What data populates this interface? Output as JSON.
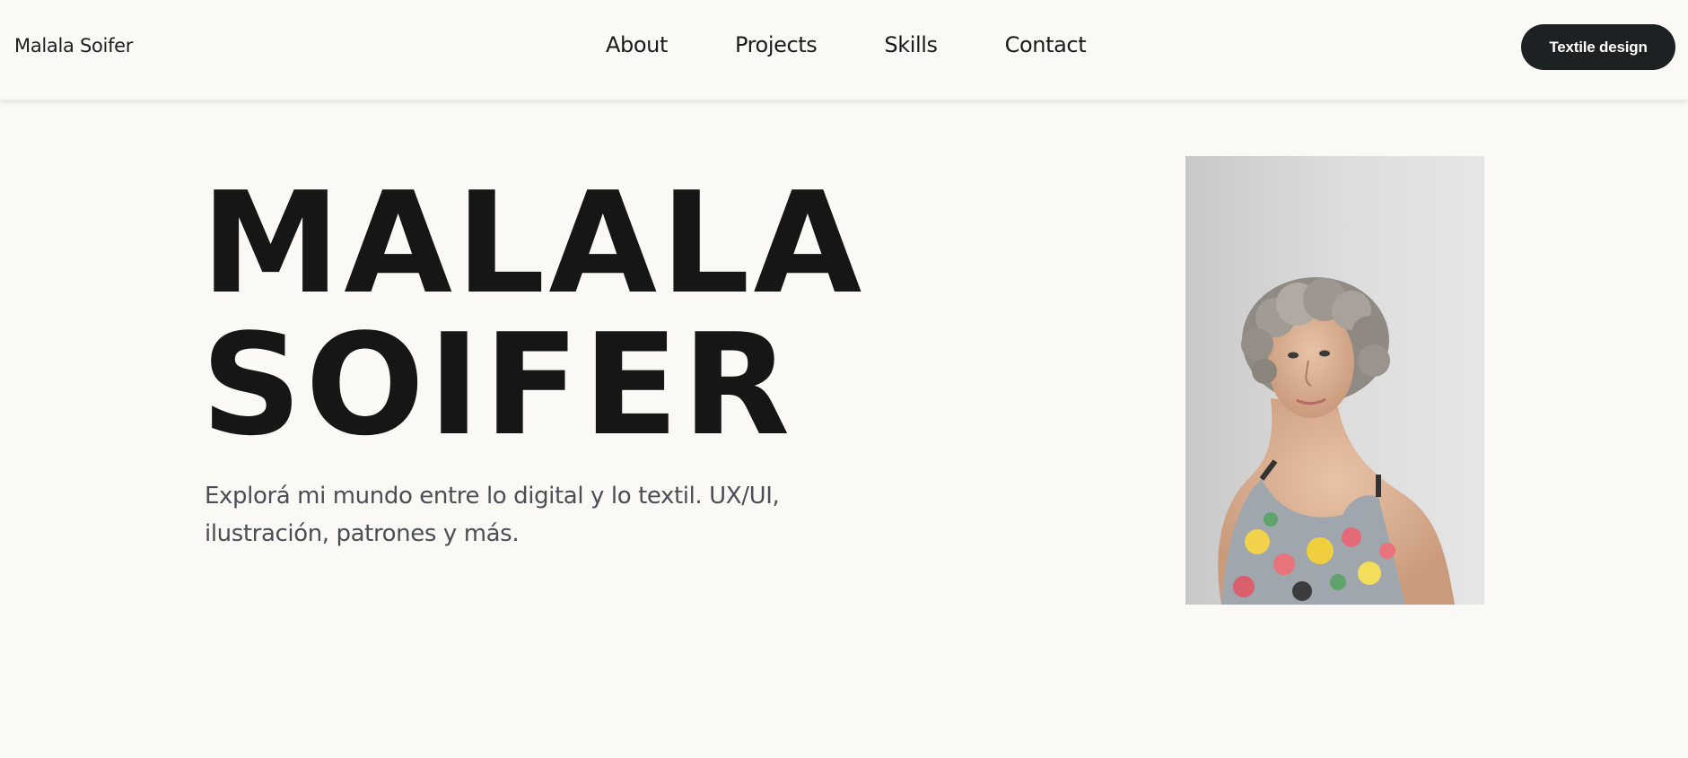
{
  "header": {
    "brand": "Malala Soifer",
    "nav": [
      {
        "label": "About"
      },
      {
        "label": "Projects"
      },
      {
        "label": "Skills"
      },
      {
        "label": "Contact"
      }
    ],
    "cta_label": "Textile design"
  },
  "hero": {
    "title_line1": "MALALA",
    "title_line2": "SOIFER",
    "subtitle": "Explorá mi mundo entre lo digital y lo textil. UX/UI, ilustración, patrones y más."
  },
  "colors": {
    "background": "#faf9f6",
    "text": "#161616",
    "subtitle": "#4b4e55",
    "button": "#1e2124"
  }
}
